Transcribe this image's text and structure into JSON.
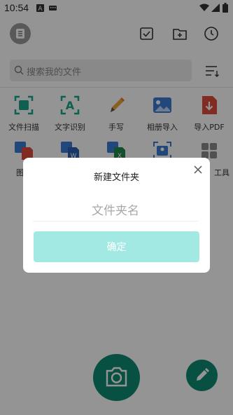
{
  "status_bar": {
    "time": "10:54"
  },
  "search": {
    "placeholder": "搜索我的文件"
  },
  "tools_row1": [
    {
      "label": "文件扫描",
      "icon": "scan-file-icon"
    },
    {
      "label": "文字识别",
      "icon": "text-recognition-icon"
    },
    {
      "label": "手写",
      "icon": "handwriting-pen-icon"
    },
    {
      "label": "相册导入",
      "icon": "album-import-icon"
    },
    {
      "label": "导入PDF",
      "icon": "import-pdf-icon"
    }
  ],
  "tools_row2": [
    {
      "label": "图转",
      "icon": "image-to-pdf-icon"
    },
    {
      "label": "",
      "icon": "image-to-word-icon"
    },
    {
      "label": "",
      "icon": "image-to-excel-icon"
    },
    {
      "label": "",
      "icon": "id-card-icon"
    },
    {
      "label": "工具",
      "icon": "grid-tools-icon"
    }
  ],
  "dialog": {
    "title": "新建文件夹",
    "input_placeholder": "文件夹名",
    "confirm_label": "确定"
  },
  "colors": {
    "accent": "#0f8a73",
    "confirm_disabled": "#a3e9e3"
  }
}
